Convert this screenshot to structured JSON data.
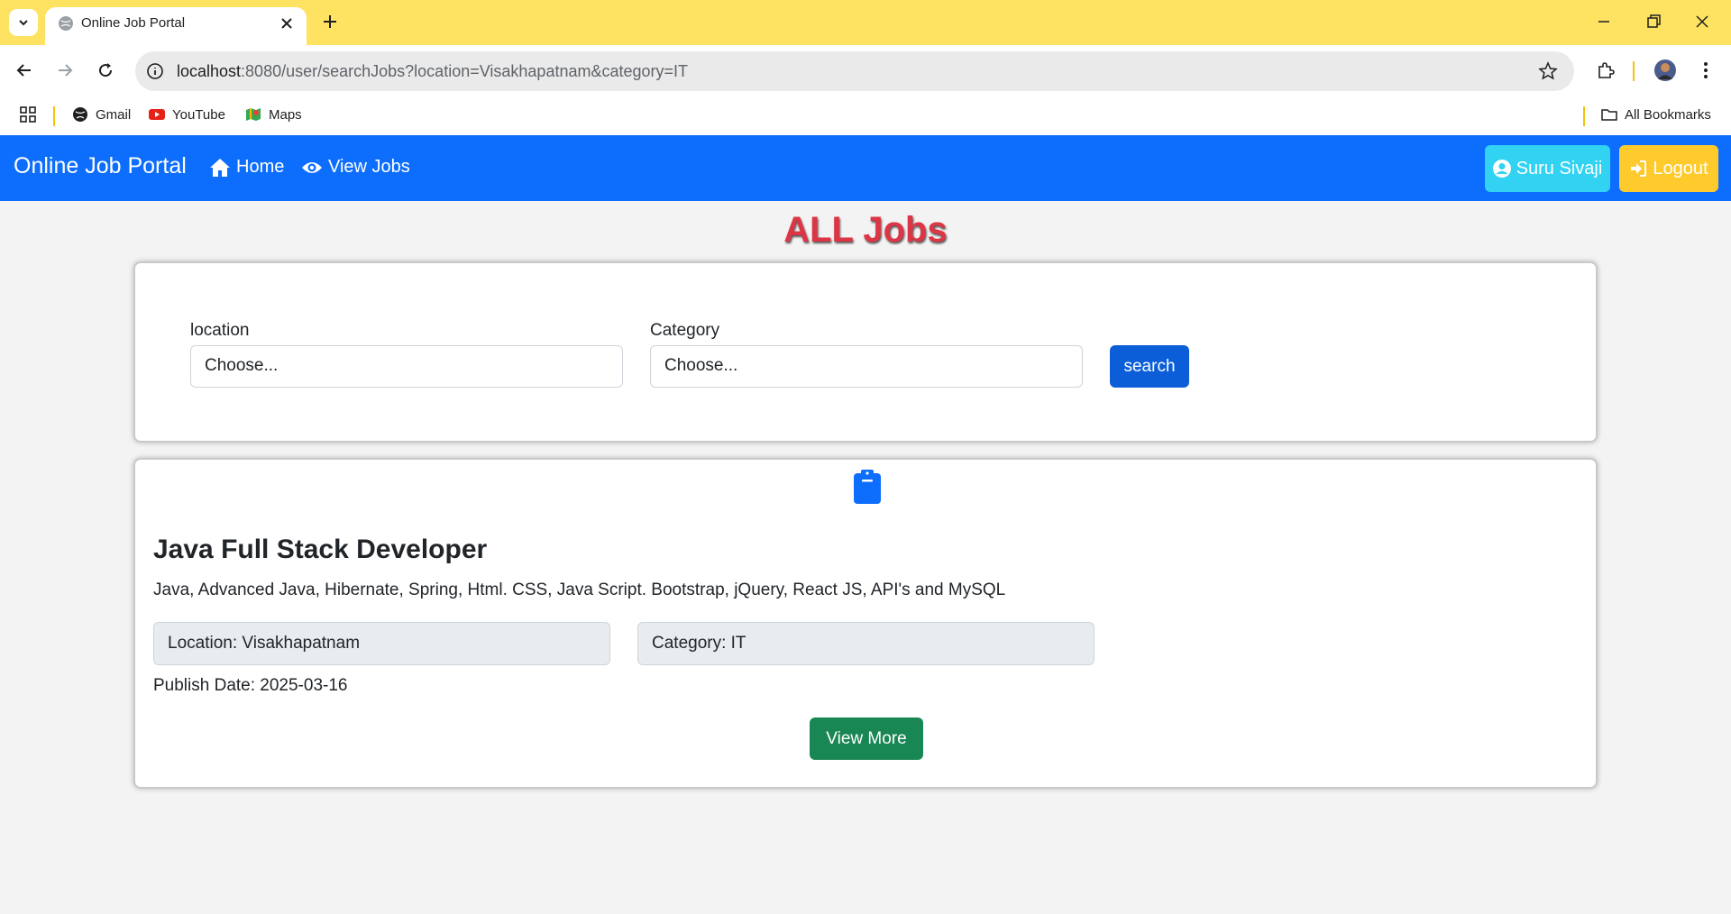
{
  "browser": {
    "tab_title": "Online Job Portal",
    "url_host": "localhost",
    "url_rest": ":8080/user/searchJobs?location=Visakhapatnam&category=IT",
    "bookmarks": [
      {
        "label": "Gmail",
        "icon": "globe-icon"
      },
      {
        "label": "YouTube",
        "icon": "youtube-icon"
      },
      {
        "label": "Maps",
        "icon": "maps-icon"
      }
    ],
    "all_bookmarks_label": "All Bookmarks"
  },
  "navbar": {
    "brand": "Online Job Portal",
    "home_label": "Home",
    "view_jobs_label": "View Jobs",
    "user_label": "Suru Sivaji",
    "logout_label": "Logout"
  },
  "page": {
    "title": "ALL Jobs"
  },
  "search": {
    "location_label": "location",
    "location_value": "Choose...",
    "category_label": "Category",
    "category_value": "Choose...",
    "search_label": "search"
  },
  "job": {
    "title": "Java Full Stack Developer",
    "description": "Java, Advanced Java, Hibernate, Spring, Html. CSS, Java Script. Bootstrap, jQuery, React JS, API's and MySQL",
    "location": "Location: Visakhapatnam",
    "category": "Category: IT",
    "publish_date": "Publish Date: 2025-03-16",
    "view_more_label": "View More"
  },
  "colors": {
    "chrome_tabstrip": "#fee262",
    "navbar": "#0d6efd",
    "title": "#dc3545",
    "user_button": "#31d2f2",
    "logout_button": "#ffca2c",
    "search_button": "#0b5ed7",
    "view_more_button": "#198754"
  }
}
